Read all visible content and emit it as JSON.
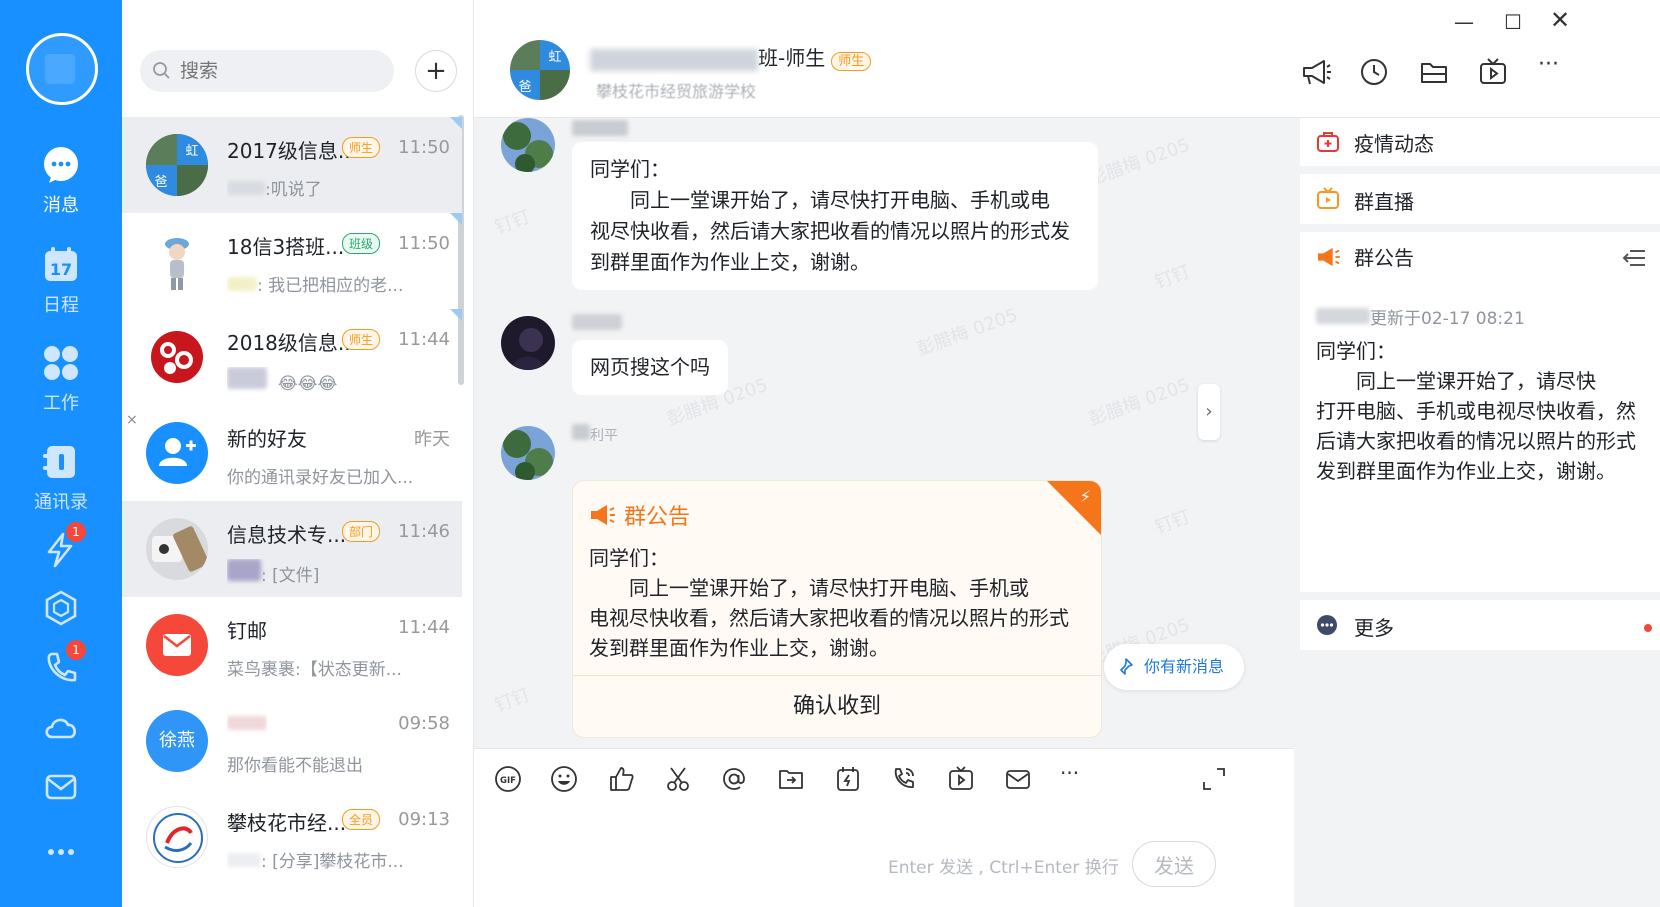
{
  "nav": {
    "items": [
      {
        "label": "消息",
        "icon": "chat-icon"
      },
      {
        "label": "日程",
        "icon": "calendar-icon",
        "icon_text": "17"
      },
      {
        "label": "工作",
        "icon": "apps-icon"
      },
      {
        "label": "通讯录",
        "icon": "contacts-icon"
      }
    ],
    "ding_badge": "1",
    "phone_badge": "1"
  },
  "search": {
    "placeholder": "搜索"
  },
  "conversations": [
    {
      "name": "2017级信息...",
      "tag": "师生",
      "time": "11:50",
      "preview": ":叽说了"
    },
    {
      "name": "18信3搭班...",
      "tag": "班级",
      "time": "11:50",
      "preview": ": 我已把相应的老..."
    },
    {
      "name": "2018级信息...",
      "tag": "师生",
      "time": "11:44",
      "preview": "😂😂😂"
    },
    {
      "name": "新的好友",
      "tag": "",
      "time": "昨天",
      "preview": "你的通讯录好友已加入..."
    },
    {
      "name": "信息技术专...",
      "tag": "部门",
      "time": "11:46",
      "preview": ": [文件]"
    },
    {
      "name": "钉邮",
      "tag": "",
      "time": "11:44",
      "preview": "菜鸟裹裹:【状态更新..."
    },
    {
      "name": "",
      "tag": "",
      "time": "09:58",
      "preview": "那你看能不能退出",
      "avatar_text": "徐燕"
    },
    {
      "name": "攀枝花市经...",
      "tag": "全员",
      "time": "09:13",
      "preview": ": [分享]攀枝花市..."
    }
  ],
  "chat": {
    "title_suffix": "班-师生",
    "title_tag": "师生",
    "subtitle": "攀枝花市经贸旅游学校",
    "group_avatar_text": [
      "虹",
      "爸"
    ],
    "messages": [
      {
        "sender": "",
        "lines": [
          "同学们：",
          "　　同上一堂课开始了，请尽快打开电脑、手机或电",
          "视尽快收看，然后请大家把收看的情况以照片的形式发",
          "到群里面作为作业上交，谢谢。"
        ]
      },
      {
        "sender": "",
        "lines": [
          "网页搜这个吗"
        ]
      },
      {
        "sender": "利平"
      }
    ],
    "notice": {
      "title": "群公告",
      "lines": [
        "同学们：",
        "　　同上一堂课开始了，请尽快打开电脑、手机或",
        "电视尽快收看，然后请大家把收看的情况以照片的形式",
        "发到群里面作为作业上交，谢谢。"
      ],
      "confirm": "确认收到"
    },
    "new_message": "你有新消息",
    "watermark": "彭腊梅 0205",
    "watermark2": "钉钉"
  },
  "input": {
    "hint": "Enter 发送 , Ctrl+Enter 换行",
    "send": "发送",
    "gif": "GIF"
  },
  "panel": {
    "epidemic": "疫情动态",
    "live": "群直播",
    "announcement": "群公告",
    "ann_meta": "更新于02-17 08:21",
    "ann_lines": [
      "同学们：",
      "　　同上一堂课开始了，请尽快",
      "打开电脑、手机或电视尽快收看，然",
      "后请大家把收看的情况以照片的形式",
      "发到群里面作为作业上交，谢谢。"
    ],
    "more": "更多"
  },
  "colors": {
    "brand": "#1890ff",
    "accent_orange": "#f5761a",
    "badge_red": "#f5483b"
  }
}
